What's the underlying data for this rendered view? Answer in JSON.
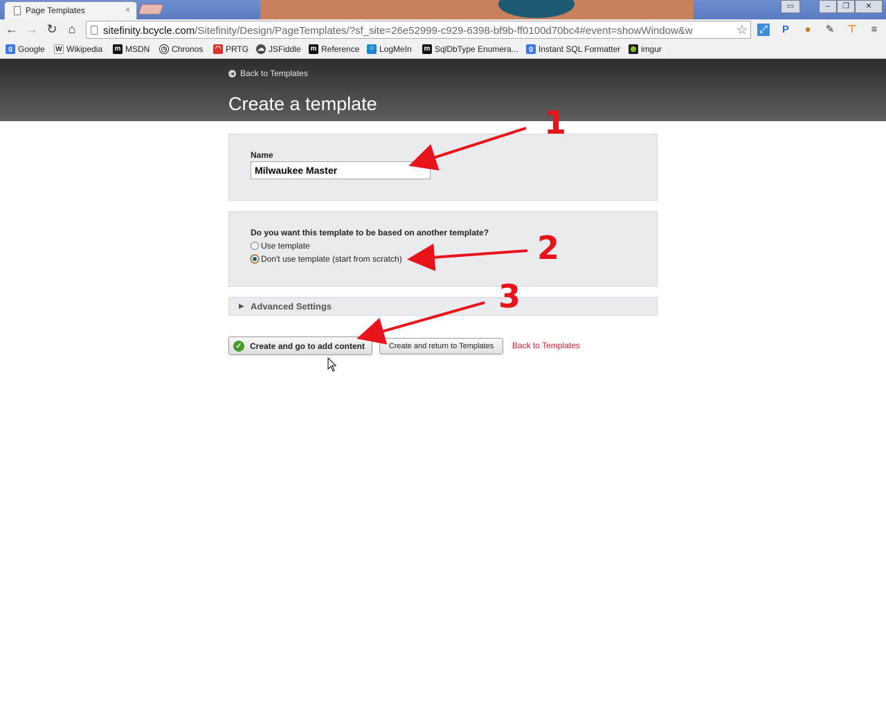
{
  "browser": {
    "tab_title": "Page Templates",
    "tab_close": "×",
    "url_host": "sitefinity.bcycle.com",
    "url_path": "/Sitefinity/Design/PageTemplates/?sf_site=26e52999-c929-6398-bf9b-ff0100d70bc4#event=showWindow&w",
    "bookmarks": [
      {
        "label": "Google",
        "icon": "google-icon",
        "color": "#3b78e7"
      },
      {
        "label": "Wikipedia",
        "icon": "wikipedia-icon",
        "color": "#222222"
      },
      {
        "label": "MSDN",
        "icon": "msdn-icon",
        "color": "#111111"
      },
      {
        "label": "Chronos",
        "icon": "chronos-icon",
        "color": "#222222"
      },
      {
        "label": "PRTG",
        "icon": "prtg-icon",
        "color": "#d9342b"
      },
      {
        "label": "JSFiddle",
        "icon": "jsfiddle-icon",
        "color": "#4b4b4b"
      },
      {
        "label": "Reference",
        "icon": "reference-icon",
        "color": "#111111"
      },
      {
        "label": "LogMeIn",
        "icon": "logmein-icon",
        "color": "#1a86d0"
      },
      {
        "label": "SqlDbType Enumera...",
        "icon": "msdn-icon",
        "color": "#111111"
      },
      {
        "label": "Instant SQL Formatter",
        "icon": "google-icon",
        "color": "#3b78e7"
      },
      {
        "label": "imgur",
        "icon": "imgur-icon",
        "color": "#85bf25"
      }
    ]
  },
  "header": {
    "back_label": "Back to Templates",
    "title": "Create a template"
  },
  "form": {
    "name_label": "Name",
    "name_value": "Milwaukee Master",
    "template_question": "Do you want this template to be based on another template?",
    "option_use": "Use template",
    "option_scratch": "Don't use template (start from scratch)",
    "selected_option": "option_scratch",
    "advanced_label": "Advanced Settings"
  },
  "actions": {
    "create_content": "Create and go to add content",
    "create_return": "Create and return to Templates",
    "back_link": "Back to Templates"
  },
  "annotations": {
    "n1": "1",
    "n2": "2",
    "n3": "3",
    "color": "#e8141b"
  }
}
